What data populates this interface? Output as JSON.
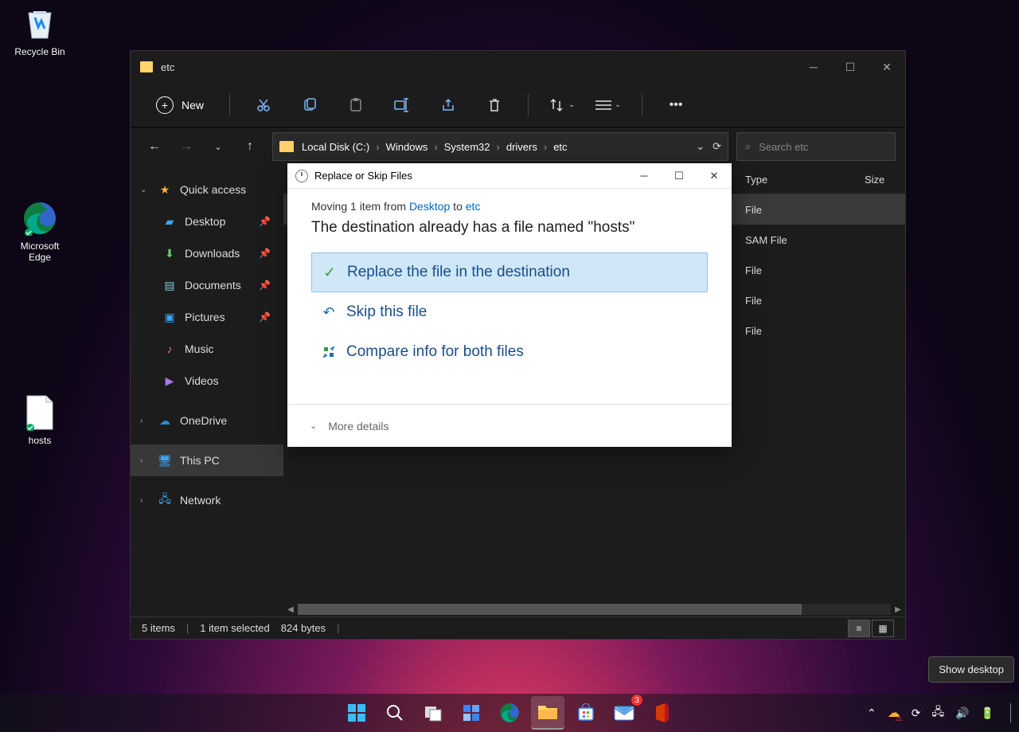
{
  "desktop": {
    "recycle": "Recycle Bin",
    "edge": "Microsoft Edge",
    "hosts": "hosts"
  },
  "explorer": {
    "title": "etc",
    "new_label": "New",
    "breadcrumb": [
      "Local Disk (C:)",
      "Windows",
      "System32",
      "drivers",
      "etc"
    ],
    "search_placeholder": "Search etc",
    "sidebar": {
      "quick": "Quick access",
      "desktop": "Desktop",
      "downloads": "Downloads",
      "documents": "Documents",
      "pictures": "Pictures",
      "music": "Music",
      "videos": "Videos",
      "onedrive": "OneDrive",
      "thispc": "This PC",
      "network": "Network"
    },
    "columns": {
      "type": "Type",
      "size": "Size"
    },
    "rows": [
      {
        "type": "File",
        "sel": true
      },
      {
        "type": "SAM File",
        "sel": false
      },
      {
        "type": "File",
        "sel": false
      },
      {
        "type": "File",
        "sel": false
      },
      {
        "type": "File",
        "sel": false
      }
    ],
    "status": {
      "count": "5 items",
      "selected": "1 item selected",
      "bytes": "824 bytes"
    }
  },
  "dialog": {
    "title": "Replace or Skip Files",
    "moving_prefix": "Moving 1 item from ",
    "moving_from": "Desktop",
    "moving_mid": " to ",
    "moving_to": "etc",
    "message": "The destination already has a file named \"hosts\"",
    "opt_replace": "Replace the file in the destination",
    "opt_skip": "Skip this file",
    "opt_compare": "Compare info for both files",
    "more": "More details"
  },
  "tooltip": "Show desktop",
  "taskbar": {
    "badge": "3"
  }
}
